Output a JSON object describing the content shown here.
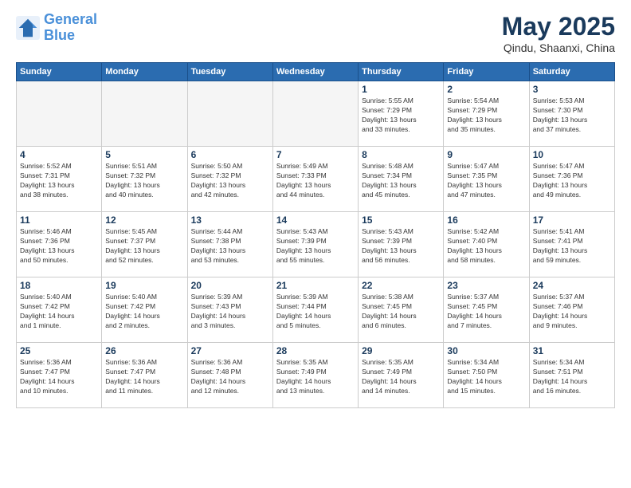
{
  "logo": {
    "line1": "General",
    "line2": "Blue"
  },
  "title": "May 2025",
  "location": "Qindu, Shaanxi, China",
  "weekdays": [
    "Sunday",
    "Monday",
    "Tuesday",
    "Wednesday",
    "Thursday",
    "Friday",
    "Saturday"
  ],
  "weeks": [
    [
      {
        "day": "",
        "info": "",
        "empty": true
      },
      {
        "day": "",
        "info": "",
        "empty": true
      },
      {
        "day": "",
        "info": "",
        "empty": true
      },
      {
        "day": "",
        "info": "",
        "empty": true
      },
      {
        "day": "1",
        "info": "Sunrise: 5:55 AM\nSunset: 7:29 PM\nDaylight: 13 hours\nand 33 minutes."
      },
      {
        "day": "2",
        "info": "Sunrise: 5:54 AM\nSunset: 7:29 PM\nDaylight: 13 hours\nand 35 minutes."
      },
      {
        "day": "3",
        "info": "Sunrise: 5:53 AM\nSunset: 7:30 PM\nDaylight: 13 hours\nand 37 minutes."
      }
    ],
    [
      {
        "day": "4",
        "info": "Sunrise: 5:52 AM\nSunset: 7:31 PM\nDaylight: 13 hours\nand 38 minutes."
      },
      {
        "day": "5",
        "info": "Sunrise: 5:51 AM\nSunset: 7:32 PM\nDaylight: 13 hours\nand 40 minutes."
      },
      {
        "day": "6",
        "info": "Sunrise: 5:50 AM\nSunset: 7:32 PM\nDaylight: 13 hours\nand 42 minutes."
      },
      {
        "day": "7",
        "info": "Sunrise: 5:49 AM\nSunset: 7:33 PM\nDaylight: 13 hours\nand 44 minutes."
      },
      {
        "day": "8",
        "info": "Sunrise: 5:48 AM\nSunset: 7:34 PM\nDaylight: 13 hours\nand 45 minutes."
      },
      {
        "day": "9",
        "info": "Sunrise: 5:47 AM\nSunset: 7:35 PM\nDaylight: 13 hours\nand 47 minutes."
      },
      {
        "day": "10",
        "info": "Sunrise: 5:47 AM\nSunset: 7:36 PM\nDaylight: 13 hours\nand 49 minutes."
      }
    ],
    [
      {
        "day": "11",
        "info": "Sunrise: 5:46 AM\nSunset: 7:36 PM\nDaylight: 13 hours\nand 50 minutes."
      },
      {
        "day": "12",
        "info": "Sunrise: 5:45 AM\nSunset: 7:37 PM\nDaylight: 13 hours\nand 52 minutes."
      },
      {
        "day": "13",
        "info": "Sunrise: 5:44 AM\nSunset: 7:38 PM\nDaylight: 13 hours\nand 53 minutes."
      },
      {
        "day": "14",
        "info": "Sunrise: 5:43 AM\nSunset: 7:39 PM\nDaylight: 13 hours\nand 55 minutes."
      },
      {
        "day": "15",
        "info": "Sunrise: 5:43 AM\nSunset: 7:39 PM\nDaylight: 13 hours\nand 56 minutes."
      },
      {
        "day": "16",
        "info": "Sunrise: 5:42 AM\nSunset: 7:40 PM\nDaylight: 13 hours\nand 58 minutes."
      },
      {
        "day": "17",
        "info": "Sunrise: 5:41 AM\nSunset: 7:41 PM\nDaylight: 13 hours\nand 59 minutes."
      }
    ],
    [
      {
        "day": "18",
        "info": "Sunrise: 5:40 AM\nSunset: 7:42 PM\nDaylight: 14 hours\nand 1 minute."
      },
      {
        "day": "19",
        "info": "Sunrise: 5:40 AM\nSunset: 7:42 PM\nDaylight: 14 hours\nand 2 minutes."
      },
      {
        "day": "20",
        "info": "Sunrise: 5:39 AM\nSunset: 7:43 PM\nDaylight: 14 hours\nand 3 minutes."
      },
      {
        "day": "21",
        "info": "Sunrise: 5:39 AM\nSunset: 7:44 PM\nDaylight: 14 hours\nand 5 minutes."
      },
      {
        "day": "22",
        "info": "Sunrise: 5:38 AM\nSunset: 7:45 PM\nDaylight: 14 hours\nand 6 minutes."
      },
      {
        "day": "23",
        "info": "Sunrise: 5:37 AM\nSunset: 7:45 PM\nDaylight: 14 hours\nand 7 minutes."
      },
      {
        "day": "24",
        "info": "Sunrise: 5:37 AM\nSunset: 7:46 PM\nDaylight: 14 hours\nand 9 minutes."
      }
    ],
    [
      {
        "day": "25",
        "info": "Sunrise: 5:36 AM\nSunset: 7:47 PM\nDaylight: 14 hours\nand 10 minutes."
      },
      {
        "day": "26",
        "info": "Sunrise: 5:36 AM\nSunset: 7:47 PM\nDaylight: 14 hours\nand 11 minutes."
      },
      {
        "day": "27",
        "info": "Sunrise: 5:36 AM\nSunset: 7:48 PM\nDaylight: 14 hours\nand 12 minutes."
      },
      {
        "day": "28",
        "info": "Sunrise: 5:35 AM\nSunset: 7:49 PM\nDaylight: 14 hours\nand 13 minutes."
      },
      {
        "day": "29",
        "info": "Sunrise: 5:35 AM\nSunset: 7:49 PM\nDaylight: 14 hours\nand 14 minutes."
      },
      {
        "day": "30",
        "info": "Sunrise: 5:34 AM\nSunset: 7:50 PM\nDaylight: 14 hours\nand 15 minutes."
      },
      {
        "day": "31",
        "info": "Sunrise: 5:34 AM\nSunset: 7:51 PM\nDaylight: 14 hours\nand 16 minutes."
      }
    ]
  ]
}
